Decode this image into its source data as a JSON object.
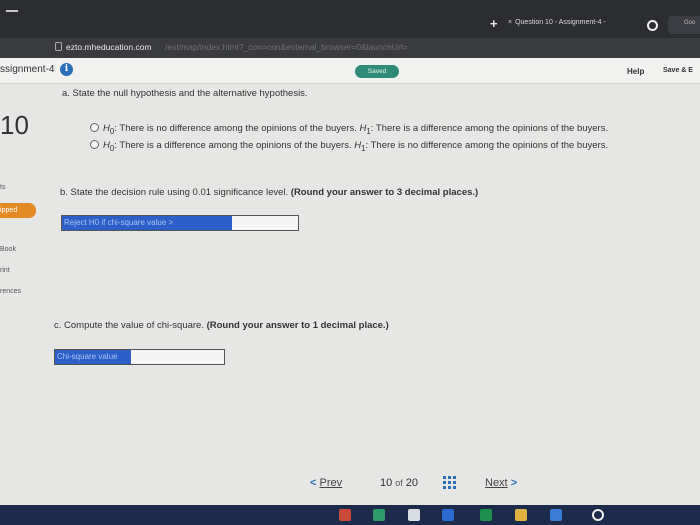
{
  "browser": {
    "new_tab_symbol": "+",
    "active_tab_close": "×",
    "active_tab_title": "Question 10 - Assignment-4 -",
    "second_tab_label": "Goo",
    "url": "ezto.mheducation.com",
    "url_rest": "/ext/map/index.html?_con=con&external_browser=0&launchUrl="
  },
  "header": {
    "assignment_title": "ssignment-4",
    "info_icon_glyph": "i",
    "saved_label": "Saved",
    "help_label": "Help",
    "save_exit_label": "Save & E"
  },
  "left_rail": {
    "question_number": "10",
    "points_label": "ts",
    "skipped_label": "ipped",
    "ebook_label": "Book",
    "print_label": "rint",
    "references_label": "rences"
  },
  "question": {
    "part_a": "a. State the null hypothesis and the alternative hypothesis.",
    "options": [
      {
        "h0": "H",
        "h0_sub": "0",
        "h0_text": ": There is no difference among the opinions of the buyers.",
        "h1": "H",
        "h1_sub": "1",
        "h1_text": ": There is a difference among the opinions of the buyers."
      },
      {
        "h0": "H",
        "h0_sub": "0",
        "h0_text": ": There is a difference among the opinions of the buyers.",
        "h1": "H",
        "h1_sub": "1",
        "h1_text": ": There is no difference among the opinions of the buyers."
      }
    ],
    "part_b_text": "b. State the decision rule using 0.01 significance level.",
    "part_b_bold": "(Round your answer to 3 decimal places.)",
    "decision_rule_placeholder": "Reject H0 if chi-square value >",
    "decision_rule_value": "",
    "part_c_text": "c. Compute the value of chi-square.",
    "part_c_bold": "(Round your answer to 1 decimal place.)",
    "chi_square_placeholder": "Chi-square value",
    "chi_square_value": ""
  },
  "pager": {
    "prev_chevron": "<",
    "prev_label": "Prev",
    "current": "10",
    "of_label": "of",
    "total": "20",
    "next_label": "Next",
    "next_chevron": ">"
  },
  "taskbar": {
    "icons": [
      {
        "name": "edge-icon",
        "color": "#c94a3a"
      },
      {
        "name": "chrome-icon",
        "color": "#2e9a6b"
      },
      {
        "name": "photos-icon",
        "color": "#d9dde4"
      },
      {
        "name": "word-icon",
        "color": "#2b6bd1"
      },
      {
        "name": "excel-icon",
        "color": "#1f8f4e"
      },
      {
        "name": "files-icon",
        "color": "#e0b040"
      },
      {
        "name": "mail-icon",
        "color": "#3a7bd5"
      },
      {
        "name": "store-icon",
        "color": "#3c78c8"
      }
    ],
    "taskview_glyph": "⌗"
  }
}
